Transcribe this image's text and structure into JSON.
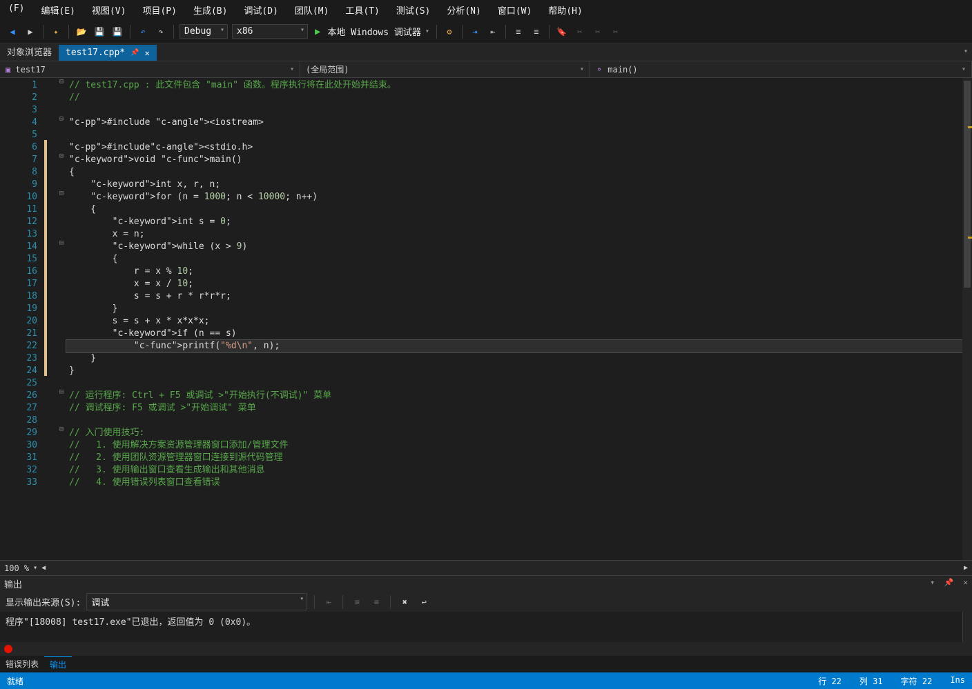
{
  "menu": [
    "(F)",
    "编辑(E)",
    "视图(V)",
    "项目(P)",
    "生成(B)",
    "调试(D)",
    "团队(M)",
    "工具(T)",
    "测试(S)",
    "分析(N)",
    "窗口(W)",
    "帮助(H)"
  ],
  "toolbar": {
    "config": "Debug",
    "platform": "x86",
    "debugger_label": "本地 Windows 调试器"
  },
  "doc_tabs": {
    "inactive": "对象浏览器",
    "active": "test17.cpp*"
  },
  "nav": {
    "project": "test17",
    "scope": "(全局范围)",
    "func": "main()"
  },
  "code_lines": [
    "// test17.cpp : 此文件包含 \"main\" 函数。程序执行将在此处开始并结束。",
    "//",
    "",
    "#include <iostream>",
    "",
    "#include<stdio.h>",
    "void main()",
    "{",
    "    int x, r, n;",
    "    for (n = 1000; n < 10000; n++)",
    "    {",
    "        int s = 0;",
    "        x = n;",
    "        while (x > 9)",
    "        {",
    "            r = x % 10;",
    "            x = x / 10;",
    "            s = s + r * r*r*r;",
    "        }",
    "        s = s + x * x*x*x;",
    "        if (n == s)",
    "            printf(\"%d\\n\", n);",
    "    }",
    "}",
    "",
    "// 运行程序: Ctrl + F5 或调试 >\"开始执行(不调试)\" 菜单",
    "// 调试程序: F5 或调试 >\"开始调试\" 菜单",
    "",
    "// 入门使用技巧:",
    "//   1. 使用解决方案资源管理器窗口添加/管理文件",
    "//   2. 使用团队资源管理器窗口连接到源代码管理",
    "//   3. 使用输出窗口查看生成输出和其他消息",
    "//   4. 使用错误列表窗口查看错误"
  ],
  "cursor_line": 22,
  "zoom": "100 %",
  "output": {
    "title": "输出",
    "source_label": "显示输出来源(S):",
    "source_value": "调试",
    "body": "程序\"[18008] test17.exe\"已退出，返回值为 0 (0x0)。"
  },
  "bottom_tabs": [
    "错误列表",
    "输出"
  ],
  "status": {
    "left": "就绪",
    "row_label": "行",
    "row": "22",
    "col_label": "列",
    "col": "31",
    "ch_label": "字符",
    "ch": "22",
    "ins": "Ins"
  }
}
